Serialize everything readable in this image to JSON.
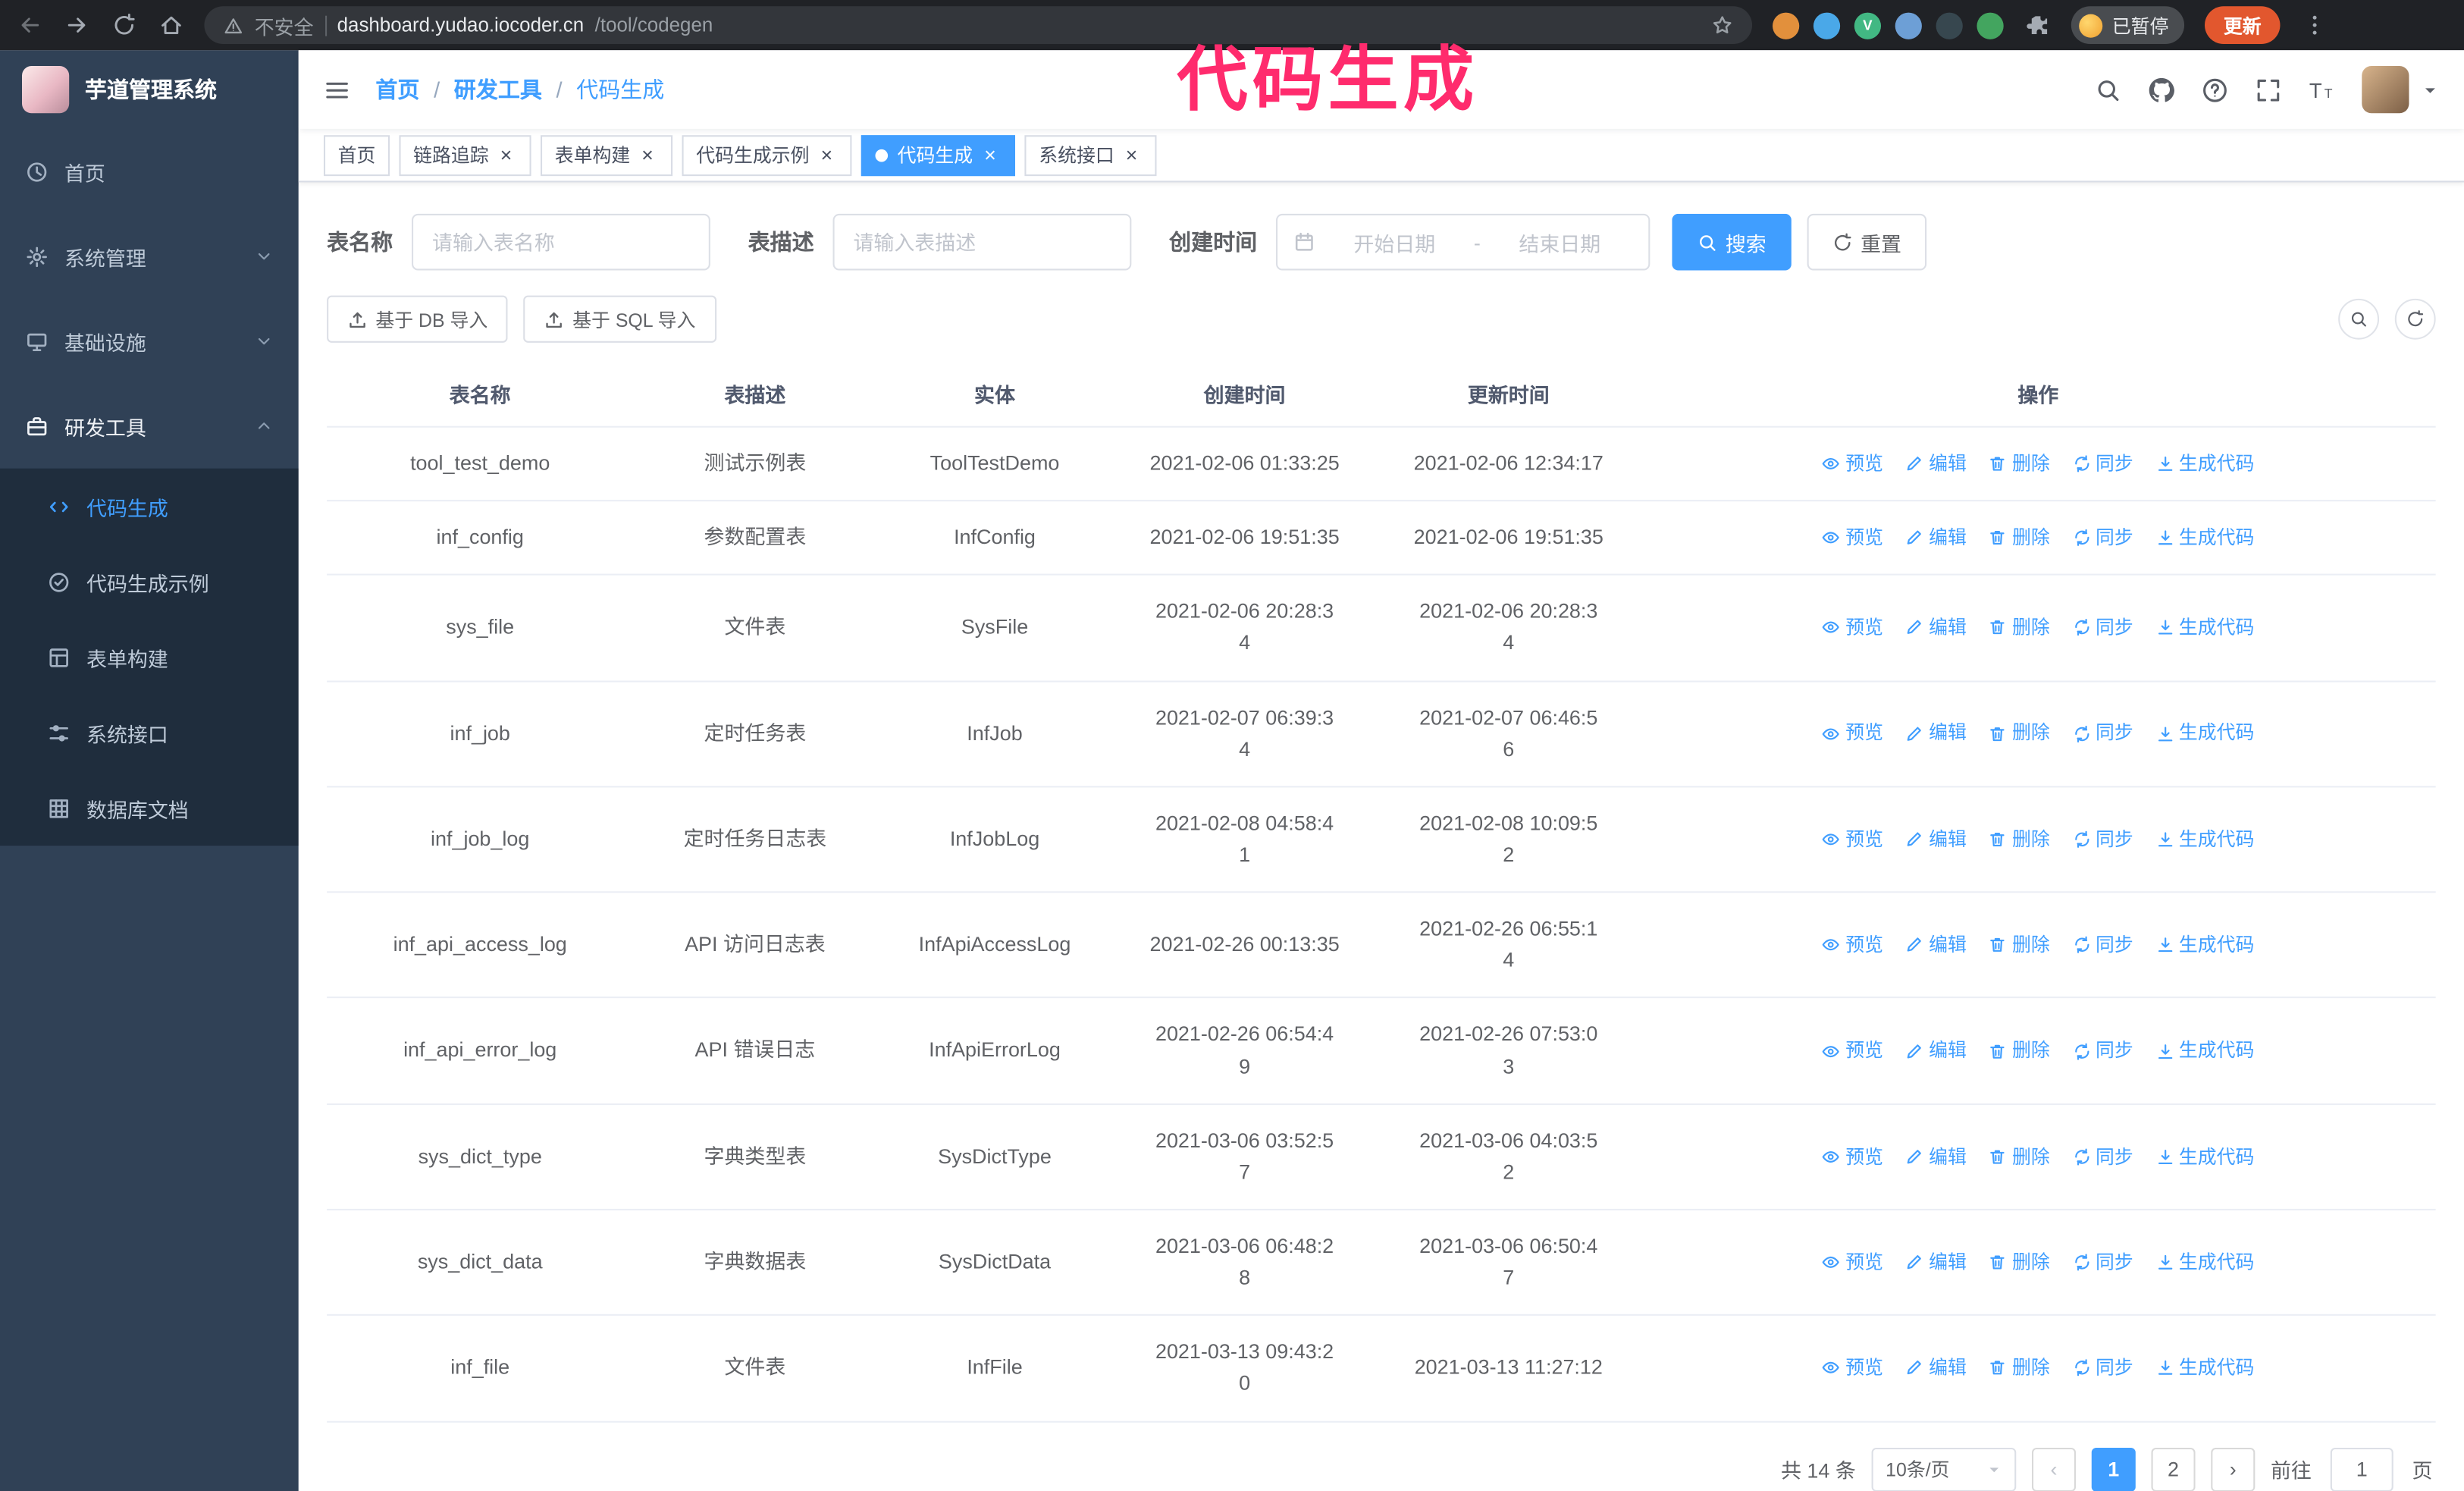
{
  "colors": {
    "accent": "#409eff",
    "annotation": "#ff2b6d",
    "sidebar_bg": "#304156",
    "submenu_bg": "#1f2d3d",
    "update_button": "#e2572e"
  },
  "annotation": {
    "text": "代码生成"
  },
  "browser": {
    "not_secure": "不安全",
    "url_host": "dashboard.yudao.iocoder.cn",
    "url_path": "/tool/codegen",
    "profile_badge": "已暂停",
    "update_label": "更新",
    "extensions": [
      {
        "color": "#e2903c",
        "letter": ""
      },
      {
        "color": "#4aa8e8",
        "letter": ""
      },
      {
        "color": "#42b883",
        "letter": "V"
      },
      {
        "color": "#6d9fd6",
        "letter": ""
      },
      {
        "color": "#37474f",
        "letter": ""
      },
      {
        "color": "#43a55f",
        "letter": ""
      }
    ]
  },
  "sidebar": {
    "logo_title": "芋道管理系统",
    "items": [
      {
        "key": "home",
        "label": "首页",
        "icon": "dashboard-icon"
      },
      {
        "key": "system",
        "label": "系统管理",
        "icon": "gear-icon",
        "chevron": "down"
      },
      {
        "key": "infra",
        "label": "基础设施",
        "icon": "infra-icon",
        "chevron": "down"
      },
      {
        "key": "dev-tools",
        "label": "研发工具",
        "icon": "tools-icon",
        "chevron": "up",
        "active": true
      }
    ],
    "subitems": [
      {
        "key": "codegen",
        "label": "代码生成",
        "icon": "code-icon",
        "active": true
      },
      {
        "key": "codegen-example",
        "label": "代码生成示例",
        "icon": "badge-icon"
      },
      {
        "key": "form-builder",
        "label": "表单构建",
        "icon": "form-icon"
      },
      {
        "key": "system-api",
        "label": "系统接口",
        "icon": "api-icon"
      },
      {
        "key": "db-doc",
        "label": "数据库文档",
        "icon": "db-icon"
      }
    ]
  },
  "header": {
    "breadcrumb": [
      "首页",
      "研发工具",
      "代码生成"
    ],
    "separator": "/"
  },
  "tabs": [
    {
      "key": "home",
      "label": "首页",
      "closable": false,
      "active": false
    },
    {
      "key": "trace",
      "label": "链路追踪",
      "closable": true,
      "active": false
    },
    {
      "key": "form-builder",
      "label": "表单构建",
      "closable": true,
      "active": false
    },
    {
      "key": "codegen-example",
      "label": "代码生成示例",
      "closable": true,
      "active": false
    },
    {
      "key": "codegen",
      "label": "代码生成",
      "closable": true,
      "active": true
    },
    {
      "key": "system-api",
      "label": "系统接口",
      "closable": true,
      "active": false
    }
  ],
  "filters": {
    "table_name_label": "表名称",
    "table_name_placeholder": "请输入表名称",
    "table_desc_label": "表描述",
    "table_desc_placeholder": "请输入表描述",
    "create_time_label": "创建时间",
    "date_start_placeholder": "开始日期",
    "date_separator": "-",
    "date_end_placeholder": "结束日期",
    "search_label": "搜索",
    "reset_label": "重置"
  },
  "toolbar": {
    "import_db_label": "基于 DB 导入",
    "import_sql_label": "基于 SQL 导入"
  },
  "table": {
    "columns": [
      "表名称",
      "表描述",
      "实体",
      "创建时间",
      "更新时间",
      "操作"
    ],
    "actions": [
      {
        "key": "preview",
        "label": "预览",
        "icon": "eye-icon"
      },
      {
        "key": "edit",
        "label": "编辑",
        "icon": "edit-icon"
      },
      {
        "key": "delete",
        "label": "删除",
        "icon": "delete-icon"
      },
      {
        "key": "sync",
        "label": "同步",
        "icon": "sync-icon"
      },
      {
        "key": "generate",
        "label": "生成代码",
        "icon": "generate-icon"
      }
    ],
    "rows": [
      {
        "name": "tool_test_demo",
        "desc": "测试示例表",
        "entity": "ToolTestDemo",
        "created": "2021-02-06 01:33:25",
        "created_wrap": false,
        "updated": "2021-02-06 12:34:17",
        "updated_wrap": false
      },
      {
        "name": "inf_config",
        "desc": "参数配置表",
        "entity": "InfConfig",
        "created": "2021-02-06 19:51:35",
        "created_wrap": false,
        "updated": "2021-02-06 19:51:35",
        "updated_wrap": false
      },
      {
        "name": "sys_file",
        "desc": "文件表",
        "entity": "SysFile",
        "created": "2021-02-06 20:28:34",
        "created_wrap": true,
        "updated": "2021-02-06 20:28:34",
        "updated_wrap": true
      },
      {
        "name": "inf_job",
        "desc": "定时任务表",
        "entity": "InfJob",
        "created": "2021-02-07 06:39:34",
        "created_wrap": true,
        "updated": "2021-02-07 06:46:56",
        "updated_wrap": true
      },
      {
        "name": "inf_job_log",
        "desc": "定时任务日志表",
        "entity": "InfJobLog",
        "created": "2021-02-08 04:58:41",
        "created_wrap": true,
        "updated": "2021-02-08 10:09:52",
        "updated_wrap": true
      },
      {
        "name": "inf_api_access_log",
        "desc": "API 访问日志表",
        "entity": "InfApiAccessLog",
        "created": "2021-02-26 00:13:35",
        "created_wrap": false,
        "updated": "2021-02-26 06:55:14",
        "updated_wrap": true
      },
      {
        "name": "inf_api_error_log",
        "desc": "API 错误日志",
        "entity": "InfApiErrorLog",
        "created": "2021-02-26 06:54:49",
        "created_wrap": true,
        "updated": "2021-02-26 07:53:03",
        "updated_wrap": true
      },
      {
        "name": "sys_dict_type",
        "desc": "字典类型表",
        "entity": "SysDictType",
        "created": "2021-03-06 03:52:57",
        "created_wrap": true,
        "updated": "2021-03-06 04:03:52",
        "updated_wrap": true
      },
      {
        "name": "sys_dict_data",
        "desc": "字典数据表",
        "entity": "SysDictData",
        "created": "2021-03-06 06:48:28",
        "created_wrap": true,
        "updated": "2021-03-06 06:50:47",
        "updated_wrap": true
      },
      {
        "name": "inf_file",
        "desc": "文件表",
        "entity": "InfFile",
        "created": "2021-03-13 09:43:20",
        "created_wrap": true,
        "updated": "2021-03-13 11:27:12",
        "updated_wrap": false
      }
    ]
  },
  "pagination": {
    "total": "共 14 条",
    "page_size": "10条/页",
    "prev_label": "‹",
    "next_label": "›",
    "pages": [
      "1",
      "2"
    ],
    "active_page": "1",
    "goto_prefix": "前往",
    "goto_value": "1",
    "goto_suffix": "页"
  }
}
